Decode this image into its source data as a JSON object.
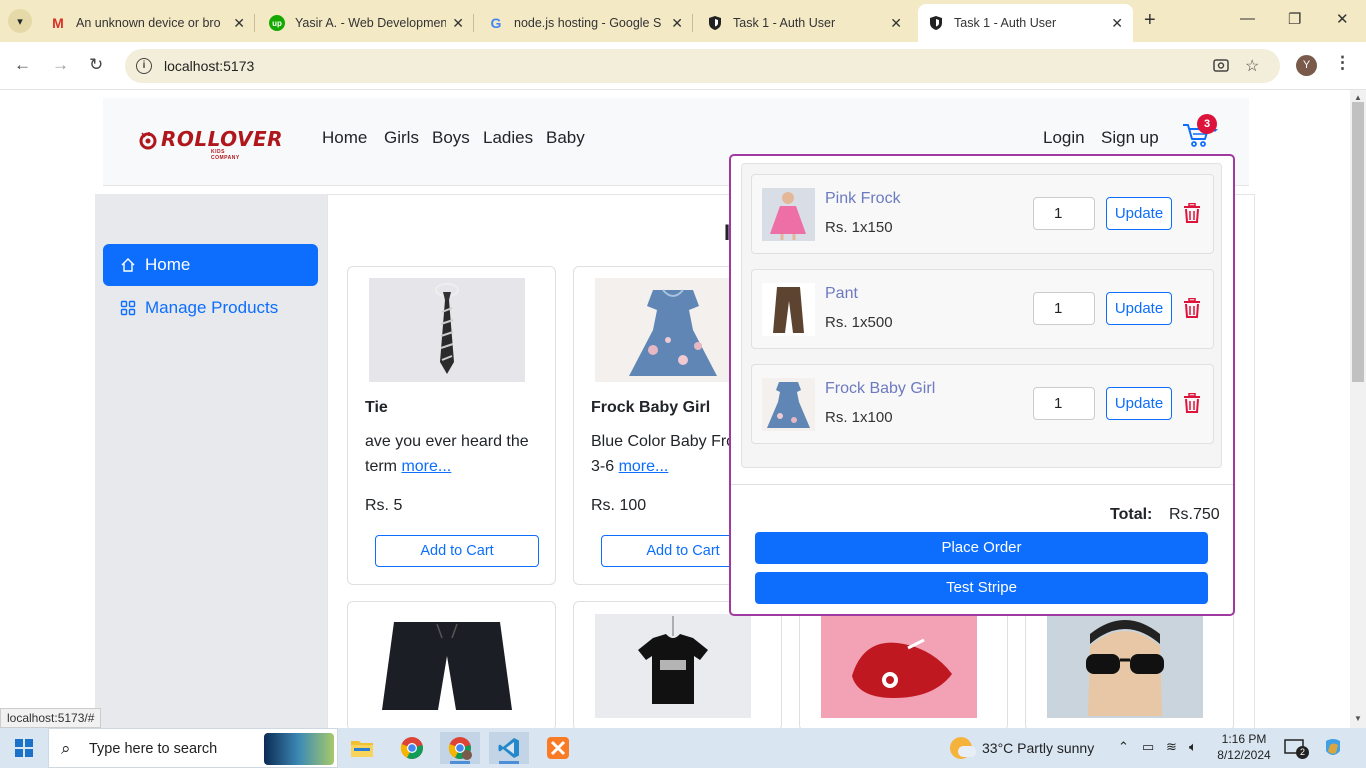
{
  "browser": {
    "tabs": [
      {
        "title": "An unknown device or bro",
        "favicon": "gmail-icon"
      },
      {
        "title": "Yasir A. - Web Developmen",
        "favicon": "upwork-icon"
      },
      {
        "title": "node.js hosting - Google S",
        "favicon": "google-icon"
      },
      {
        "title": "Task 1 - Auth User",
        "favicon": "shield-icon"
      },
      {
        "title": "Task 1 - Auth User",
        "favicon": "shield-icon",
        "active": true
      }
    ],
    "url": "localhost:5173",
    "profile_initial": "Y",
    "status_url": "localhost:5173/#"
  },
  "navbar": {
    "logo_text": "ROLLOVER",
    "logo_sub": "KIDS COMPANY",
    "links": [
      "Home",
      "Girls",
      "Boys",
      "Ladies",
      "Baby"
    ],
    "login": "Login",
    "signup": "Sign up",
    "cart_count": "3"
  },
  "sidebar": {
    "items": [
      {
        "label": "Home",
        "icon": "house-icon",
        "active": true
      },
      {
        "label": "Manage Products",
        "icon": "grid-icon",
        "active": false
      }
    ]
  },
  "main": {
    "heading_partial": "I",
    "products": [
      {
        "title": "Tie",
        "desc": "ave you ever heard the term",
        "more": "more...",
        "price": "Rs. 5",
        "button": "Add to Cart"
      },
      {
        "title": "Frock Baby Girl",
        "desc": "Blue Color Baby Fro Age 3-6",
        "more": "more...",
        "price": "Rs. 100",
        "button": "Add to Cart"
      }
    ]
  },
  "cart": {
    "items": [
      {
        "name": "Pink Frock",
        "qty_line": "Rs. 1x150",
        "qty": "1",
        "update": "Update"
      },
      {
        "name": "Pant",
        "qty_line": "Rs. 1x500",
        "qty": "1",
        "update": "Update"
      },
      {
        "name": "Frock Baby Girl",
        "qty_line": "Rs. 1x100",
        "qty": "1",
        "update": "Update"
      }
    ],
    "total_label": "Total:",
    "total_value": "Rs.750",
    "place_order": "Place Order",
    "test_stripe": "Test Stripe"
  },
  "taskbar": {
    "search_placeholder": "Type here to search",
    "weather": "33°C  Partly sunny",
    "time": "1:16 PM",
    "date": "8/12/2024",
    "notifications": "2"
  },
  "colors": {
    "primary": "#0d6efd",
    "cart_border": "#a03aa0",
    "danger": "#dc143c",
    "brand": "#b0171d"
  }
}
